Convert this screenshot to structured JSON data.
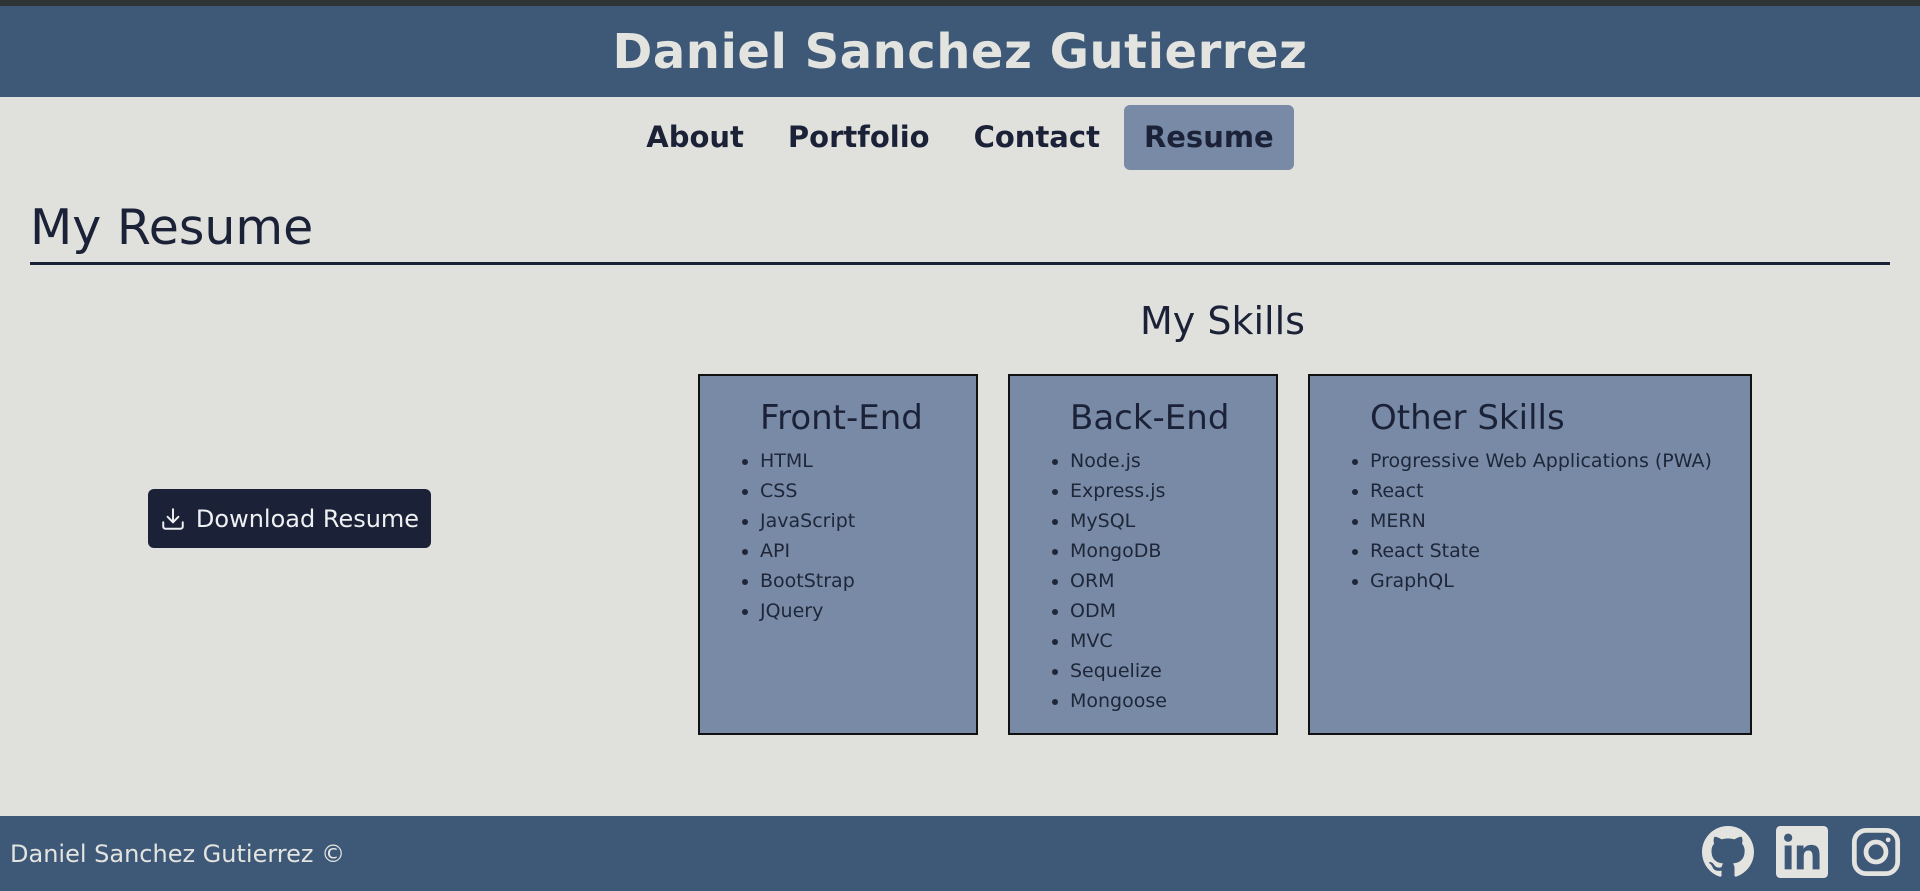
{
  "header": {
    "title": "Daniel Sanchez Gutierrez"
  },
  "nav": {
    "items": [
      {
        "label": "About"
      },
      {
        "label": "Portfolio"
      },
      {
        "label": "Contact"
      },
      {
        "label": "Resume",
        "active": true
      }
    ]
  },
  "page": {
    "heading": "My Resume"
  },
  "download": {
    "label": "Download Resume",
    "icon": "download-icon"
  },
  "skills": {
    "title": "My Skills",
    "front_end": {
      "title": "Front-End",
      "items": [
        "HTML",
        "CSS",
        "JavaScript",
        "API",
        "BootStrap",
        "JQuery"
      ]
    },
    "back_end": {
      "title": "Back-End",
      "items": [
        "Node.js",
        "Express.js",
        "MySQL",
        "MongoDB",
        "ORM",
        "ODM",
        "MVC",
        "Sequelize",
        "Mongoose"
      ]
    },
    "other": {
      "title": "Other Skills",
      "items": [
        "Progressive Web Applications (PWA)",
        "React",
        "MERN",
        "React State",
        "GraphQL"
      ]
    }
  },
  "footer": {
    "text": "Daniel Sanchez Gutierrez ©",
    "social": [
      "github-icon",
      "linkedin-icon",
      "instagram-icon"
    ]
  },
  "colors": {
    "header_bg": "#3e5877",
    "page_bg": "#e0e0dc",
    "card_bg": "#788aa6",
    "dark": "#1b2238"
  }
}
